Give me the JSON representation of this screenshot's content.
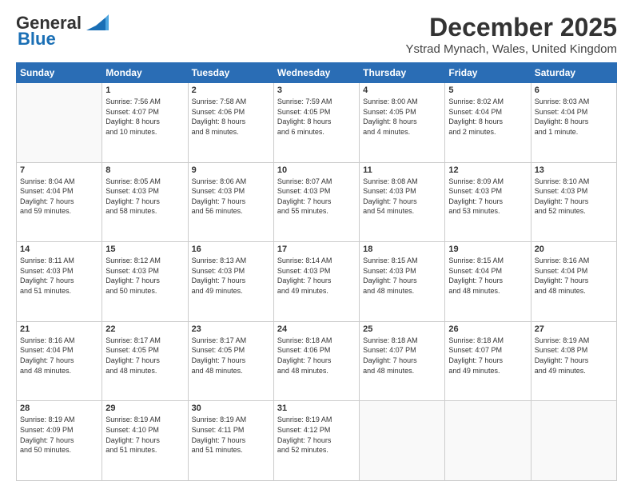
{
  "logo": {
    "general": "General",
    "blue": "Blue"
  },
  "title": "December 2025",
  "location": "Ystrad Mynach, Wales, United Kingdom",
  "weekdays": [
    "Sunday",
    "Monday",
    "Tuesday",
    "Wednesday",
    "Thursday",
    "Friday",
    "Saturday"
  ],
  "weeks": [
    [
      {
        "day": "",
        "info": ""
      },
      {
        "day": "1",
        "info": "Sunrise: 7:56 AM\nSunset: 4:07 PM\nDaylight: 8 hours\nand 10 minutes."
      },
      {
        "day": "2",
        "info": "Sunrise: 7:58 AM\nSunset: 4:06 PM\nDaylight: 8 hours\nand 8 minutes."
      },
      {
        "day": "3",
        "info": "Sunrise: 7:59 AM\nSunset: 4:05 PM\nDaylight: 8 hours\nand 6 minutes."
      },
      {
        "day": "4",
        "info": "Sunrise: 8:00 AM\nSunset: 4:05 PM\nDaylight: 8 hours\nand 4 minutes."
      },
      {
        "day": "5",
        "info": "Sunrise: 8:02 AM\nSunset: 4:04 PM\nDaylight: 8 hours\nand 2 minutes."
      },
      {
        "day": "6",
        "info": "Sunrise: 8:03 AM\nSunset: 4:04 PM\nDaylight: 8 hours\nand 1 minute."
      }
    ],
    [
      {
        "day": "7",
        "info": "Sunrise: 8:04 AM\nSunset: 4:04 PM\nDaylight: 7 hours\nand 59 minutes."
      },
      {
        "day": "8",
        "info": "Sunrise: 8:05 AM\nSunset: 4:03 PM\nDaylight: 7 hours\nand 58 minutes."
      },
      {
        "day": "9",
        "info": "Sunrise: 8:06 AM\nSunset: 4:03 PM\nDaylight: 7 hours\nand 56 minutes."
      },
      {
        "day": "10",
        "info": "Sunrise: 8:07 AM\nSunset: 4:03 PM\nDaylight: 7 hours\nand 55 minutes."
      },
      {
        "day": "11",
        "info": "Sunrise: 8:08 AM\nSunset: 4:03 PM\nDaylight: 7 hours\nand 54 minutes."
      },
      {
        "day": "12",
        "info": "Sunrise: 8:09 AM\nSunset: 4:03 PM\nDaylight: 7 hours\nand 53 minutes."
      },
      {
        "day": "13",
        "info": "Sunrise: 8:10 AM\nSunset: 4:03 PM\nDaylight: 7 hours\nand 52 minutes."
      }
    ],
    [
      {
        "day": "14",
        "info": "Sunrise: 8:11 AM\nSunset: 4:03 PM\nDaylight: 7 hours\nand 51 minutes."
      },
      {
        "day": "15",
        "info": "Sunrise: 8:12 AM\nSunset: 4:03 PM\nDaylight: 7 hours\nand 50 minutes."
      },
      {
        "day": "16",
        "info": "Sunrise: 8:13 AM\nSunset: 4:03 PM\nDaylight: 7 hours\nand 49 minutes."
      },
      {
        "day": "17",
        "info": "Sunrise: 8:14 AM\nSunset: 4:03 PM\nDaylight: 7 hours\nand 49 minutes."
      },
      {
        "day": "18",
        "info": "Sunrise: 8:15 AM\nSunset: 4:03 PM\nDaylight: 7 hours\nand 48 minutes."
      },
      {
        "day": "19",
        "info": "Sunrise: 8:15 AM\nSunset: 4:04 PM\nDaylight: 7 hours\nand 48 minutes."
      },
      {
        "day": "20",
        "info": "Sunrise: 8:16 AM\nSunset: 4:04 PM\nDaylight: 7 hours\nand 48 minutes."
      }
    ],
    [
      {
        "day": "21",
        "info": "Sunrise: 8:16 AM\nSunset: 4:04 PM\nDaylight: 7 hours\nand 48 minutes."
      },
      {
        "day": "22",
        "info": "Sunrise: 8:17 AM\nSunset: 4:05 PM\nDaylight: 7 hours\nand 48 minutes."
      },
      {
        "day": "23",
        "info": "Sunrise: 8:17 AM\nSunset: 4:05 PM\nDaylight: 7 hours\nand 48 minutes."
      },
      {
        "day": "24",
        "info": "Sunrise: 8:18 AM\nSunset: 4:06 PM\nDaylight: 7 hours\nand 48 minutes."
      },
      {
        "day": "25",
        "info": "Sunrise: 8:18 AM\nSunset: 4:07 PM\nDaylight: 7 hours\nand 48 minutes."
      },
      {
        "day": "26",
        "info": "Sunrise: 8:18 AM\nSunset: 4:07 PM\nDaylight: 7 hours\nand 49 minutes."
      },
      {
        "day": "27",
        "info": "Sunrise: 8:19 AM\nSunset: 4:08 PM\nDaylight: 7 hours\nand 49 minutes."
      }
    ],
    [
      {
        "day": "28",
        "info": "Sunrise: 8:19 AM\nSunset: 4:09 PM\nDaylight: 7 hours\nand 50 minutes."
      },
      {
        "day": "29",
        "info": "Sunrise: 8:19 AM\nSunset: 4:10 PM\nDaylight: 7 hours\nand 51 minutes."
      },
      {
        "day": "30",
        "info": "Sunrise: 8:19 AM\nSunset: 4:11 PM\nDaylight: 7 hours\nand 51 minutes."
      },
      {
        "day": "31",
        "info": "Sunrise: 8:19 AM\nSunset: 4:12 PM\nDaylight: 7 hours\nand 52 minutes."
      },
      {
        "day": "",
        "info": ""
      },
      {
        "day": "",
        "info": ""
      },
      {
        "day": "",
        "info": ""
      }
    ]
  ]
}
